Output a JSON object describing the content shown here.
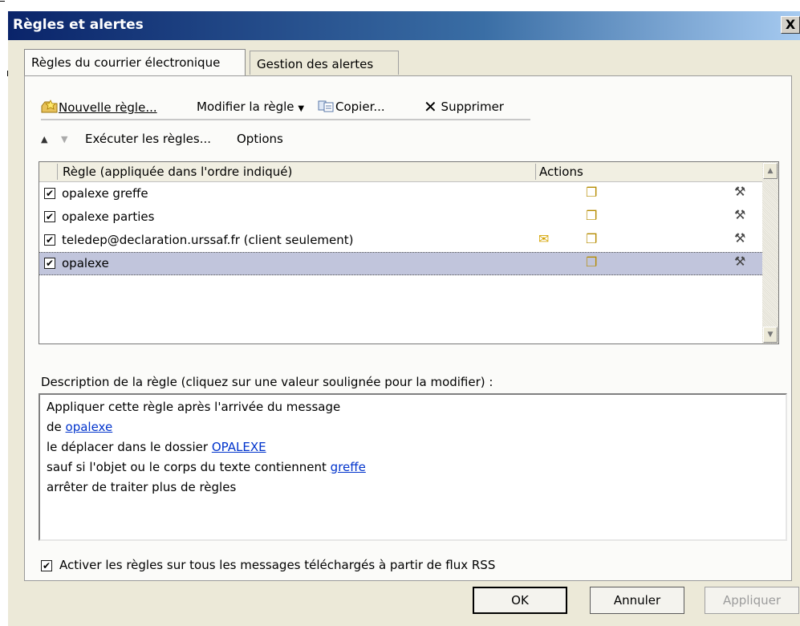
{
  "window": {
    "title": "Règles et alertes",
    "close_glyph": "X"
  },
  "tabs": [
    {
      "label": "Règles du courrier électronique",
      "active": true
    },
    {
      "label": "Gestion des alertes",
      "active": false
    }
  ],
  "toolbar": {
    "new_rule": "Nouvelle règle...",
    "modify_rule": "Modifier la règle",
    "copy": "Copier...",
    "delete": "Supprimer",
    "run_rules": "Exécuter les règles...",
    "options": "Options"
  },
  "rules_table": {
    "col_rule": "Règle (appliquée dans l'ordre indiqué)",
    "col_actions": "Actions",
    "rows": [
      {
        "name": "opalexe greffe",
        "checked": true,
        "client_only": false
      },
      {
        "name": "opalexe parties",
        "checked": true,
        "client_only": false
      },
      {
        "name": "teledep@declaration.urssaf.fr  (client seulement)",
        "checked": true,
        "client_only": true
      },
      {
        "name": "opalexe",
        "checked": true,
        "client_only": false,
        "selected": true
      }
    ]
  },
  "description": {
    "label": "Description de la règle (cliquez sur une valeur soulignée pour la modifier) :",
    "line1": "Appliquer cette règle après l'arrivée du message",
    "line2_prefix": "de ",
    "line2_link": "opalexe",
    "line3_prefix": "le déplacer dans le dossier ",
    "line3_link": "OPALEXE",
    "line4_prefix": "sauf si l'objet ou le corps du texte contiennent ",
    "line4_link": "greffe",
    "line5": "arrêter de traiter plus de règles"
  },
  "rss": {
    "label": "Activer les règles sur tous les messages téléchargés à partir de flux RSS",
    "checked": true
  },
  "buttons": {
    "ok": "OK",
    "cancel": "Annuler",
    "apply": "Appliquer"
  },
  "icons": {
    "check": "✔",
    "move_to_folder": "move-to-folder-icon",
    "advanced_actions": "advanced-actions-icon",
    "client_only": "client-only-icon"
  }
}
